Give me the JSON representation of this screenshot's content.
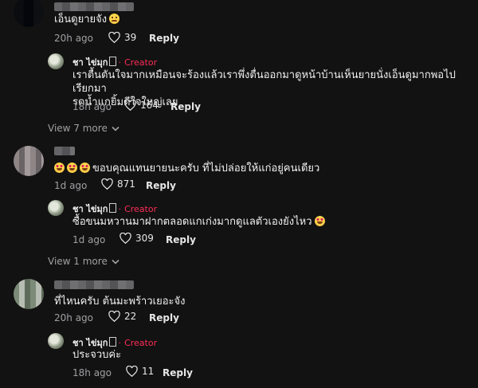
{
  "comments": [
    {
      "text": "เอ็นดูยายจัง",
      "emoji": "sad-face-emoji",
      "time": "20h ago",
      "likes": "39",
      "reply_label": "Reply",
      "creator_reply": {
        "name": "ชา ไข่มุก",
        "tag": "Creator",
        "text_line1": "เราตื้นตันใจมากเหมือนจะร้องแล้วเราพึ่งตื่นออกมาดูหน้าบ้านเห็นยายนั่งเอ็นดูมากพอไปเรียกมา",
        "text_line2": "รดน้ำแกยิ้มดีใจใหญ่เลย",
        "time": "18h ago",
        "likes": "164",
        "reply_label": "Reply"
      },
      "view_more": "View 7 more"
    },
    {
      "text": "ขอบคุณแทนยายนะครับ ที่ไม่ปล่อยให้แก่อยู่คนเดียว",
      "emoji": "smiling-face-with-hearts-emoji",
      "time": "1d ago",
      "likes": "871",
      "reply_label": "Reply",
      "creator_reply": {
        "name": "ชา ไข่มุก",
        "tag": "Creator",
        "text_line1": "ซื้อขนมหวานมาฝากตลอดแกเก่งมากดูแลตัวเองยังไหว",
        "time": "1d ago",
        "likes": "309",
        "reply_label": "Reply"
      },
      "view_more": "View 1 more"
    },
    {
      "text": "ที่ไหนครับ ต้นมะพร้าวเยอะจัง",
      "time": "20h ago",
      "likes": "22",
      "reply_label": "Reply",
      "creator_reply": {
        "name": "ชา ไข่มุก",
        "tag": "Creator",
        "text_line1": "ประจวบค่ะ",
        "time": "18h ago",
        "likes": "11",
        "reply_label": "Reply"
      }
    }
  ],
  "creator_separator": "·",
  "colors": {
    "background": "#121212",
    "creator_accent": "#fe2c55",
    "muted": "#a0a0a4"
  }
}
